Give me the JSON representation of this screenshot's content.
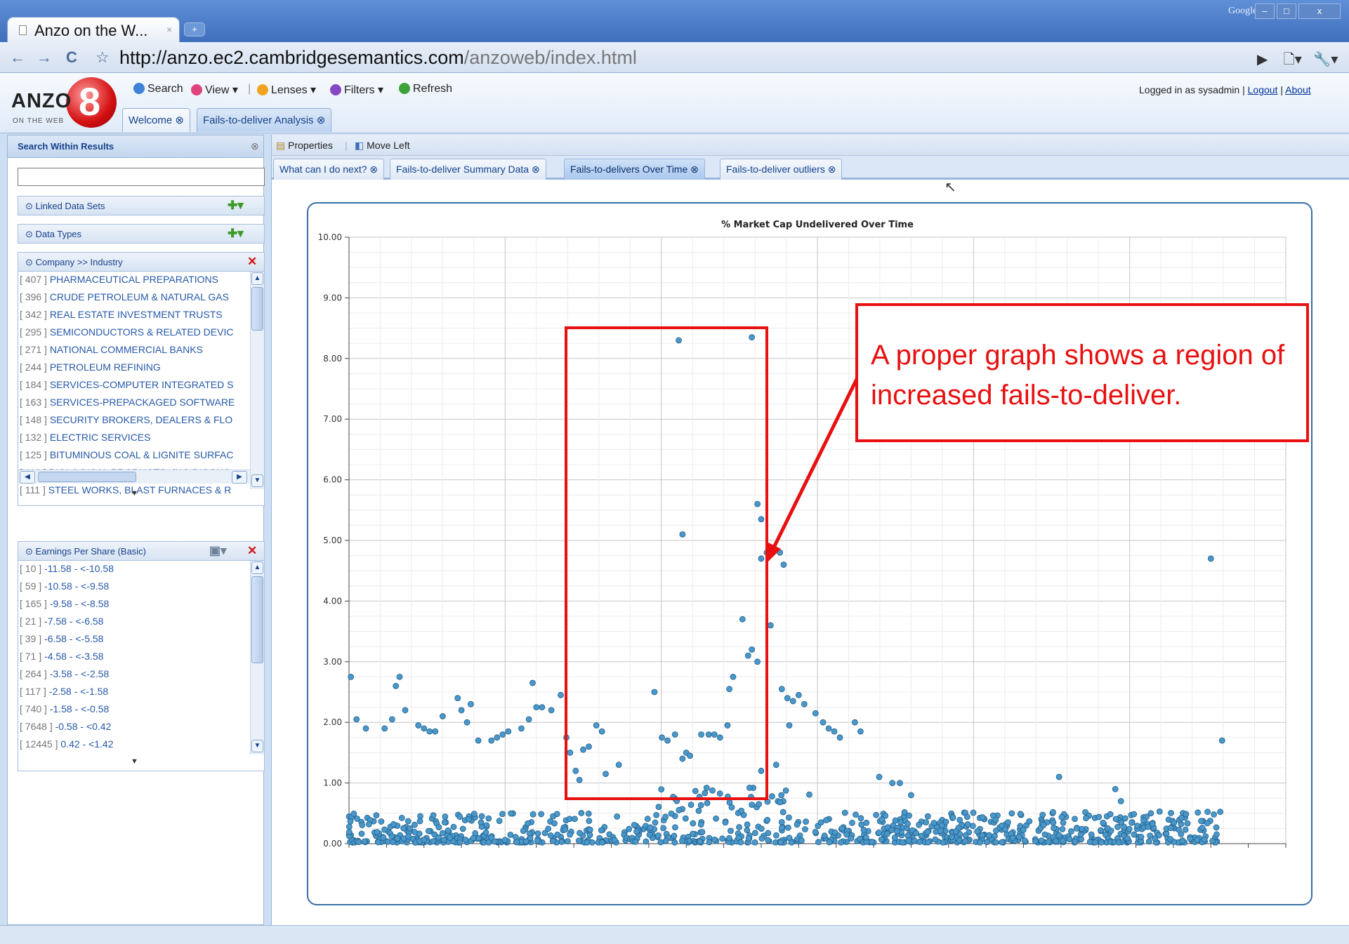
{
  "browser": {
    "tab_title": "Anzo on the W...",
    "tab_close": "×",
    "new_tab": "+",
    "google": "Google",
    "win_min": "–",
    "win_max": "□",
    "win_close": "x",
    "url_host": "http://anzo.ec2.cambridgesemantics.com",
    "url_path": "/anzoweb/index.html"
  },
  "app": {
    "logo_text": "ANZO",
    "logo_sub": "ON THE WEB",
    "toolbar": {
      "search": "Search",
      "view": "View ▾",
      "lenses": "Lenses ▾",
      "filters": "Filters ▾",
      "refresh": "Refresh"
    },
    "login_prefix": "Logged in as sysadmin | ",
    "logout": "Logout",
    "sep": " | ",
    "about": "About",
    "tabs": {
      "welcome": "Welcome ⊗",
      "analysis": "Fails-to-deliver Analysis ⊗"
    }
  },
  "left_panel": {
    "title": "Search Within Results",
    "search_value": "",
    "linked_data_sets": "⊙ Linked Data Sets",
    "data_types": "⊙ Data Types",
    "industry_header": "⊙ Company >> Industry",
    "industry_items": [
      {
        "count": "[ 407 ]",
        "label": "PHARMACEUTICAL PREPARATIONS"
      },
      {
        "count": "[ 396 ]",
        "label": "CRUDE PETROLEUM & NATURAL GAS"
      },
      {
        "count": "[ 342 ]",
        "label": "REAL ESTATE INVESTMENT TRUSTS"
      },
      {
        "count": "[ 295 ]",
        "label": "SEMICONDUCTORS & RELATED DEVIC"
      },
      {
        "count": "[ 271 ]",
        "label": "NATIONAL COMMERCIAL BANKS"
      },
      {
        "count": "[ 244 ]",
        "label": "PETROLEUM REFINING"
      },
      {
        "count": "[ 184 ]",
        "label": "SERVICES-COMPUTER INTEGRATED S"
      },
      {
        "count": "[ 163 ]",
        "label": "SERVICES-PREPACKAGED SOFTWARE"
      },
      {
        "count": "[ 148 ]",
        "label": "SECURITY BROKERS, DEALERS & FLO"
      },
      {
        "count": "[ 132 ]",
        "label": "ELECTRIC SERVICES"
      },
      {
        "count": "[ 125 ]",
        "label": "BITUMINOUS COAL & LIGNITE SURFAC"
      },
      {
        "count": "[ 113 ]",
        "label": "BIOLOGICAL PRODUCTS, (NO DISGNO"
      },
      {
        "count": "[ 111 ]",
        "label": "STEEL WORKS, BLAST FURNACES & R"
      }
    ],
    "eps_header": "⊙ Earnings Per Share (Basic)",
    "eps_items": [
      {
        "count": "[ 10 ]",
        "label": "-11.58 - <-10.58"
      },
      {
        "count": "[ 59 ]",
        "label": "-10.58 - <-9.58"
      },
      {
        "count": "[ 165 ]",
        "label": "-9.58 - <-8.58"
      },
      {
        "count": "[ 21 ]",
        "label": "-7.58 - <-6.58"
      },
      {
        "count": "[ 39 ]",
        "label": "-6.58 - <-5.58"
      },
      {
        "count": "[ 71 ]",
        "label": "-4.58 - <-3.58"
      },
      {
        "count": "[ 264 ]",
        "label": "-3.58 - <-2.58"
      },
      {
        "count": "[ 117 ]",
        "label": "-2.58 - <-1.58"
      },
      {
        "count": "[ 740 ]",
        "label": "-1.58 - <-0.58"
      },
      {
        "count": "[ 7648 ]",
        "label": "-0.58 - <0.42"
      },
      {
        "count": "[ 12445 ]",
        "label": "0.42 - <1.42"
      }
    ]
  },
  "main": {
    "toolbar": {
      "properties": "Properties",
      "move_left": "Move Left"
    },
    "tabs": [
      {
        "label": "What can I do next? ⊗"
      },
      {
        "label": "Fails-to-deliver Summary Data ⊗"
      },
      {
        "label": "Fails-to-delivers Over Time ⊗"
      },
      {
        "label": "Fails-to-deliver outliers ⊗"
      }
    ],
    "active_tab": 2
  },
  "annotation": {
    "text": "A proper graph shows a region of increased fails-to-deliver.",
    "color": "#e81010"
  },
  "chart_data": {
    "type": "scatter",
    "title": "% Market Cap Undelivered Over Time",
    "xlabel": "",
    "ylabel": "",
    "xlim": [
      0,
      50
    ],
    "ylim": [
      0,
      10
    ],
    "y_ticks": [
      "0.00",
      "1.00",
      "2.00",
      "3.00",
      "4.00",
      "5.00",
      "6.00",
      "7.00",
      "8.00",
      "9.00",
      "10.00"
    ],
    "grid": true,
    "marker_color": "#4a97c9",
    "series": [
      {
        "values": [
          [
            0.1,
            2.75
          ],
          [
            0.4,
            2.05
          ],
          [
            0.9,
            1.9
          ],
          [
            1.9,
            1.9
          ],
          [
            2.3,
            2.05
          ],
          [
            2.5,
            2.6
          ],
          [
            2.7,
            2.75
          ],
          [
            3,
            2.2
          ],
          [
            3.7,
            1.95
          ],
          [
            4,
            1.9
          ],
          [
            4.3,
            1.85
          ],
          [
            4.6,
            1.85
          ],
          [
            5,
            2.1
          ],
          [
            5.8,
            2.4
          ],
          [
            6,
            2.2
          ],
          [
            6.3,
            2
          ],
          [
            6.5,
            2.3
          ],
          [
            6.9,
            1.7
          ],
          [
            7.6,
            1.7
          ],
          [
            7.9,
            1.75
          ],
          [
            8.2,
            1.8
          ],
          [
            8.5,
            1.85
          ],
          [
            9.2,
            1.9
          ],
          [
            9.6,
            2.05
          ],
          [
            9.8,
            2.65
          ],
          [
            10,
            2.25
          ],
          [
            10.3,
            2.25
          ],
          [
            10.8,
            2.2
          ],
          [
            11.3,
            2.45
          ],
          [
            11.6,
            1.75
          ],
          [
            11.8,
            1.5
          ],
          [
            12.1,
            1.2
          ],
          [
            12.3,
            1.05
          ],
          [
            12.5,
            1.55
          ],
          [
            12.8,
            1.6
          ],
          [
            13.2,
            1.95
          ],
          [
            13.5,
            1.85
          ],
          [
            13.7,
            1.15
          ],
          [
            14.4,
            1.3
          ],
          [
            16.3,
            2.5
          ],
          [
            16.7,
            1.75
          ],
          [
            17,
            1.7
          ],
          [
            17.4,
            1.8
          ],
          [
            17.8,
            1.4
          ],
          [
            18,
            1.5
          ],
          [
            18.2,
            1.45
          ],
          [
            18.8,
            1.8
          ],
          [
            19.2,
            1.8
          ],
          [
            19.5,
            1.8
          ],
          [
            19.8,
            1.75
          ],
          [
            20.2,
            1.95
          ],
          [
            20.5,
            2.75
          ],
          [
            21.3,
            3.1
          ],
          [
            21.5,
            3.2
          ],
          [
            21.8,
            3.0
          ],
          [
            22.5,
            3.6
          ],
          [
            21,
            3.7
          ],
          [
            22,
            4.7
          ],
          [
            22.3,
            4.8
          ],
          [
            23,
            4.8
          ],
          [
            23.2,
            4.6
          ],
          [
            21.8,
            5.6
          ],
          [
            22,
            5.35
          ],
          [
            20.3,
            2.55
          ],
          [
            17.8,
            5.1
          ],
          [
            17.6,
            8.3
          ],
          [
            21.5,
            8.35
          ],
          [
            23.1,
            2.55
          ],
          [
            23.4,
            2.4
          ],
          [
            23.7,
            2.35
          ],
          [
            24,
            2.45
          ],
          [
            24.3,
            2.3
          ],
          [
            24.9,
            2.15
          ],
          [
            25.3,
            2.0
          ],
          [
            25.6,
            1.9
          ],
          [
            25.9,
            1.85
          ],
          [
            26.2,
            1.75
          ],
          [
            27,
            2.0
          ],
          [
            27.3,
            1.85
          ],
          [
            23.5,
            1.95
          ],
          [
            22,
            1.2
          ],
          [
            22.8,
            1.3
          ],
          [
            46,
            4.7
          ],
          [
            46.6,
            1.7
          ],
          [
            28.3,
            1.1
          ],
          [
            29,
            1.0
          ],
          [
            29.4,
            1.0
          ],
          [
            30,
            0.8
          ],
          [
            37.9,
            1.1
          ],
          [
            40.9,
            0.9
          ],
          [
            41.2,
            0.7
          ],
          [
            42.8,
            0.5
          ]
        ]
      }
    ],
    "dense_band": {
      "x_range": [
        0,
        46.5
      ],
      "y_range": [
        0.02,
        0.95
      ],
      "points": 900
    }
  }
}
